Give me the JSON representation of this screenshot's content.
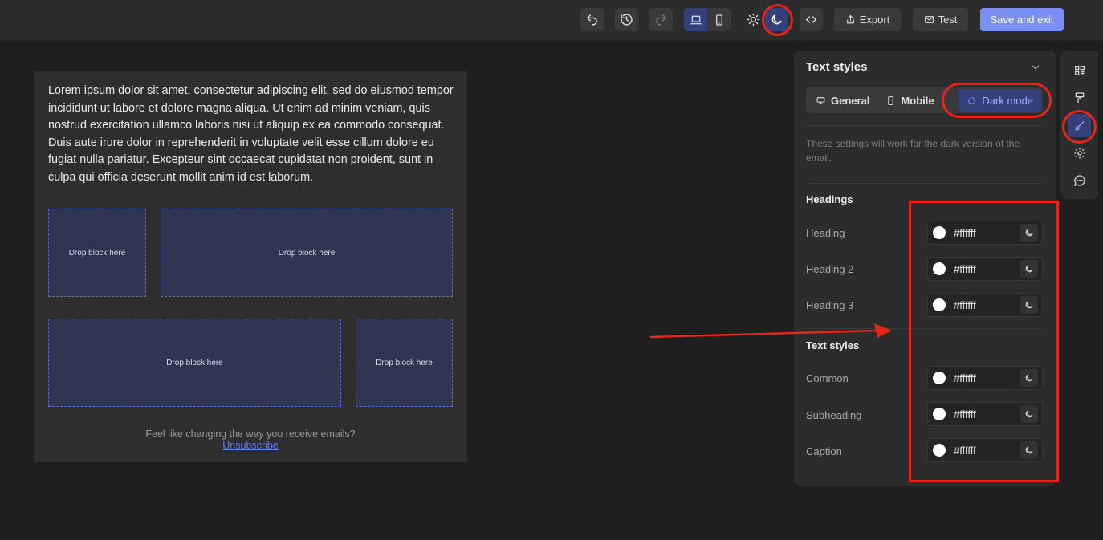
{
  "toolbar": {
    "undo_icon": "undo-icon",
    "history_icon": "history-icon",
    "redo_icon": "redo-icon",
    "desktop_icon": "laptop-icon",
    "mobile_icon": "phone-icon",
    "light_icon": "sun-icon",
    "dark_icon": "moon-icon",
    "code_icon": "code-icon",
    "export_label": "Export",
    "test_label": "Test",
    "save_label": "Save and exit"
  },
  "email": {
    "body_text": "Lorem ipsum dolor sit amet, consectetur adipiscing elit, sed do eiusmod tempor incididunt ut labore et dolore magna aliqua. Ut enim ad minim veniam, quis nostrud exercitation ullamco laboris nisi ut aliquip ex ea commodo consequat. Duis aute irure dolor in reprehenderit in voluptate velit esse cillum dolore eu fugiat nulla pariatur. Excepteur sint occaecat cupidatat non proident, sunt in culpa qui officia deserunt mollit anim id est laborum.",
    "drop_zones": [
      "Drop block here",
      "Drop block here",
      "Drop block here",
      "Drop block here"
    ],
    "footer_text": "Feel like changing the way you receive emails?",
    "unsubscribe_label": "Unsubscribe"
  },
  "panel": {
    "title": "Text styles",
    "tabs": [
      {
        "label": "General",
        "icon": "monitor-icon",
        "active": false
      },
      {
        "label": "Mobile",
        "icon": "phone-icon",
        "active": false
      },
      {
        "label": "Dark mode",
        "icon": "dark-mode-icon",
        "active": true
      }
    ],
    "hint": "These settings will work for the dark version of the email.",
    "headings_title": "Headings",
    "headings": [
      {
        "label": "Heading",
        "value": "#ffffff"
      },
      {
        "label": "Heading 2",
        "value": "#ffffff"
      },
      {
        "label": "Heading 3",
        "value": "#ffffff"
      }
    ],
    "text_styles_title": "Text styles",
    "text_styles": [
      {
        "label": "Common",
        "value": "#ffffff"
      },
      {
        "label": "Subheading",
        "value": "#ffffff"
      },
      {
        "label": "Caption",
        "value": "#ffffff"
      }
    ]
  },
  "sidebar": {
    "icons": [
      "blocks-icon",
      "paint-roller-icon",
      "brush-icon",
      "settings-icon",
      "comment-icon"
    ]
  },
  "colors": {
    "accent": "#7b8ff2",
    "active_bg": "#35407a",
    "annotation": "#e8241a",
    "swatch": "#ffffff"
  }
}
